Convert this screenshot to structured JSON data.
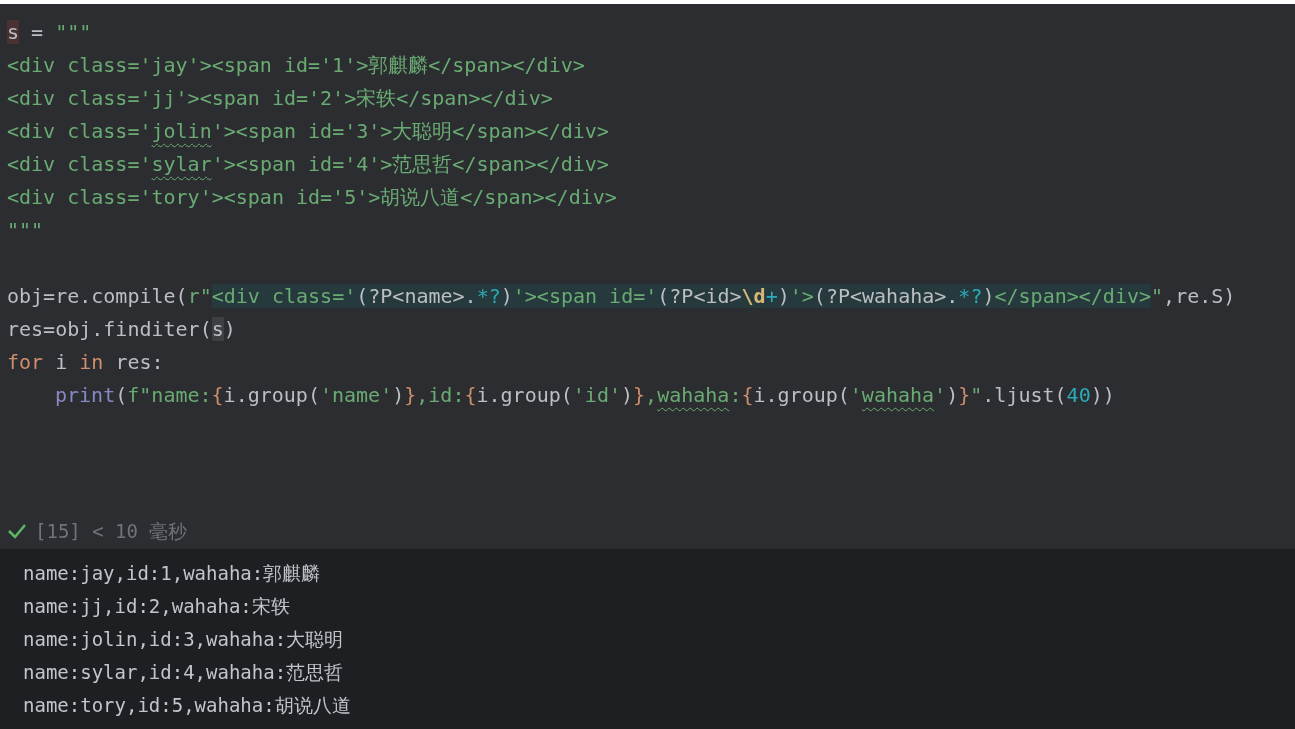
{
  "editor": {
    "blocks": [
      [
        {
          "tokens": [
            {
              "kind": "mark",
              "text": "s"
            },
            {
              "kind": "plain",
              "text": " = "
            },
            {
              "kind": "str",
              "text": "\"\"\""
            }
          ]
        },
        {
          "tokens": [
            {
              "kind": "str",
              "text": "<div class='jay'><span id='1'>郭麒麟</span></div>"
            }
          ]
        },
        {
          "tokens": [
            {
              "kind": "str",
              "text": "<div class='jj'><span id='2'>宋轶</span></div>"
            }
          ]
        },
        {
          "tokens": [
            {
              "kind": "str",
              "text": "<div class='"
            },
            {
              "kind": "str",
              "text": "jolin",
              "typo": true
            },
            {
              "kind": "str",
              "text": "'><span id='3'>大聪明</span></div>"
            }
          ]
        },
        {
          "tokens": [
            {
              "kind": "str",
              "text": "<div class='"
            },
            {
              "kind": "str",
              "text": "sylar",
              "typo": true
            },
            {
              "kind": "str",
              "text": "'><span id='4'>范思哲</span></div>"
            }
          ]
        },
        {
          "tokens": [
            {
              "kind": "str",
              "text": "<div class='tory'><span id='5'>胡说八道</span></div>"
            }
          ]
        },
        {
          "tokens": [
            {
              "kind": "str",
              "text": "\"\"\""
            }
          ]
        }
      ],
      [
        {
          "tokens": [
            {
              "kind": "plain",
              "text": "obj=re.compile("
            },
            {
              "kind": "str",
              "text": "r\""
            },
            {
              "kind": "rx",
              "text": "<div class='"
            },
            {
              "kind": "rxp",
              "text": "(?P<name>."
            },
            {
              "kind": "rxop",
              "text": "*?"
            },
            {
              "kind": "rxp",
              "text": ")"
            },
            {
              "kind": "rx",
              "text": "'><span id='"
            },
            {
              "kind": "rxp",
              "text": "(?P<id>"
            },
            {
              "kind": "rxesc",
              "text": "\\d"
            },
            {
              "kind": "rxop",
              "text": "+"
            },
            {
              "kind": "rxp",
              "text": ")"
            },
            {
              "kind": "rx",
              "text": "'>"
            },
            {
              "kind": "rxp",
              "text": "(?P<wahaha>."
            },
            {
              "kind": "rxop",
              "text": "*?"
            },
            {
              "kind": "rxp",
              "text": ")"
            },
            {
              "kind": "rx",
              "text": "</span></div>"
            },
            {
              "kind": "str",
              "text": "\""
            },
            {
              "kind": "plain",
              "text": ",re.S)"
            }
          ]
        },
        {
          "tokens": [
            {
              "kind": "plain",
              "text": "res=obj.finditer("
            },
            {
              "kind": "caret",
              "text": "s"
            },
            {
              "kind": "plain",
              "text": ")"
            }
          ]
        },
        {
          "tokens": [
            {
              "kind": "kw",
              "text": "for"
            },
            {
              "kind": "plain",
              "text": " i "
            },
            {
              "kind": "kw",
              "text": "in"
            },
            {
              "kind": "plain",
              "text": " res:"
            }
          ]
        },
        {
          "indented": true,
          "tokens": [
            {
              "kind": "builtin",
              "text": "print"
            },
            {
              "kind": "plain",
              "text": "("
            },
            {
              "kind": "str",
              "text": "f\"name:"
            },
            {
              "kind": "brace",
              "text": "{"
            },
            {
              "kind": "plain",
              "text": "i.group("
            },
            {
              "kind": "str",
              "text": "'name'"
            },
            {
              "kind": "plain",
              "text": ")"
            },
            {
              "kind": "brace",
              "text": "}"
            },
            {
              "kind": "str",
              "text": ",id:"
            },
            {
              "kind": "brace",
              "text": "{"
            },
            {
              "kind": "plain",
              "text": "i.group("
            },
            {
              "kind": "str",
              "text": "'id'"
            },
            {
              "kind": "plain",
              "text": ")"
            },
            {
              "kind": "brace",
              "text": "}"
            },
            {
              "kind": "str",
              "text": ","
            },
            {
              "kind": "str",
              "text": "wahaha",
              "typo": true
            },
            {
              "kind": "str",
              "text": ":"
            },
            {
              "kind": "brace",
              "text": "{"
            },
            {
              "kind": "plain",
              "text": "i.group("
            },
            {
              "kind": "str",
              "text": "'"
            },
            {
              "kind": "str",
              "text": "wahaha",
              "typo": true
            },
            {
              "kind": "str",
              "text": "'"
            },
            {
              "kind": "plain",
              "text": ")"
            },
            {
              "kind": "brace",
              "text": "}"
            },
            {
              "kind": "str",
              "text": "\""
            },
            {
              "kind": "plain",
              "text": ".ljust("
            },
            {
              "kind": "num",
              "text": "40"
            },
            {
              "kind": "plain",
              "text": "))"
            }
          ]
        }
      ]
    ]
  },
  "status": {
    "success": true,
    "text": "[15] < 10 毫秒"
  },
  "output": [
    "name:jay,id:1,wahaha:郭麒麟",
    "name:jj,id:2,wahaha:宋轶",
    "name:jolin,id:3,wahaha:大聪明",
    "name:sylar,id:4,wahaha:范思哲",
    "name:tory,id:5,wahaha:胡说八道"
  ]
}
